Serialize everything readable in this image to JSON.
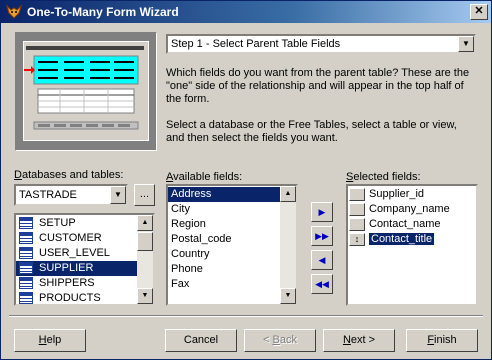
{
  "window": {
    "title": "One-To-Many Form Wizard",
    "close_glyph": "✕"
  },
  "step": {
    "selected": "Step 1 - Select Parent Table Fields"
  },
  "description": {
    "p1": "Which fields do you want from the parent table? These are the \"one\" side of the relationship and will appear in the top half of the form.",
    "p2": "Select a database or the Free Tables, select a table or view, and then select the fields you want."
  },
  "databases": {
    "label_u": "D",
    "label_rest": "atabases and tables:",
    "selected": "TASTRADE",
    "browse_label": "...",
    "tables": [
      "SETUP",
      "CUSTOMER",
      "USER_LEVEL",
      "SUPPLIER",
      "SHIPPERS",
      "PRODUCTS"
    ],
    "selected_table": "SUPPLIER"
  },
  "available": {
    "label_u": "A",
    "label_rest": "vailable fields:",
    "fields": [
      "Address",
      "City",
      "Region",
      "Postal_code",
      "Country",
      "Phone",
      "Fax"
    ],
    "selected_field": "Address"
  },
  "selected": {
    "label_u": "S",
    "label_rest": "elected fields:",
    "fields": [
      "Supplier_id",
      "Company_name",
      "Contact_name",
      "Contact_title"
    ],
    "highlighted_field": "Contact_title"
  },
  "movers": {
    "add": "▶",
    "add_all": "▶▶",
    "remove": "◀",
    "remove_all": "◀◀"
  },
  "buttons": {
    "help_u": "H",
    "help_rest": "elp",
    "cancel": "Cancel",
    "back_pre": "< ",
    "back_u": "B",
    "back_rest": "ack",
    "next_pre": "",
    "next_u": "N",
    "next_rest": "ext >",
    "finish_u": "F",
    "finish_rest": "inish"
  },
  "colors": {
    "title_start": "#0a246a",
    "selection": "#0a246a",
    "preview_highlight": "#00ffff",
    "preview_arrow": "#ff0000"
  }
}
